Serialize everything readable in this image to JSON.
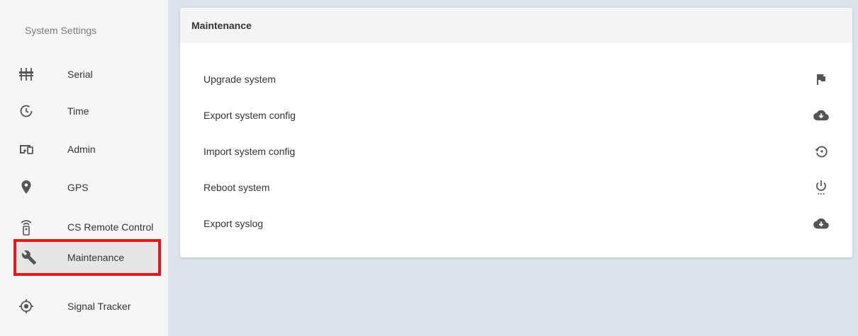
{
  "sidebar": {
    "title": "System Settings",
    "items": [
      {
        "label": "Serial",
        "icon": "serial-icon"
      },
      {
        "label": "Time",
        "icon": "clock-icon"
      },
      {
        "label": "Admin",
        "icon": "devices-icon"
      },
      {
        "label": "GPS",
        "icon": "map-pin-icon"
      },
      {
        "label": "CS Remote Control",
        "icon": "remote-control-icon"
      },
      {
        "label": "Maintenance",
        "icon": "wrench-icon",
        "active": true
      },
      {
        "label": "Signal Tracker",
        "icon": "target-icon"
      }
    ]
  },
  "main": {
    "title": "Maintenance",
    "rows": [
      {
        "label": "Upgrade system",
        "icon": "flag-icon"
      },
      {
        "label": "Export system config",
        "icon": "cloud-download-icon"
      },
      {
        "label": "Import system config",
        "icon": "restore-icon"
      },
      {
        "label": "Reboot system",
        "icon": "power-settings-icon"
      },
      {
        "label": "Export syslog",
        "icon": "cloud-download-icon"
      }
    ]
  },
  "colors": {
    "highlight": "#e8141e",
    "icon": "#555555",
    "background": "#dde3ea"
  }
}
